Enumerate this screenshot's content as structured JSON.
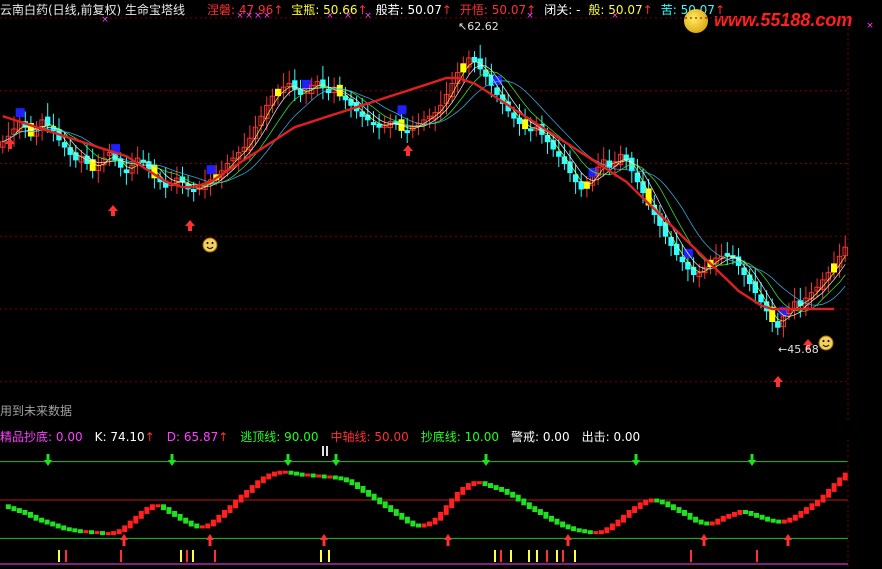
{
  "main_header": {
    "title": "云南白药(日线,前复权) 生命宝塔线",
    "items": [
      {
        "label": "涅磐",
        "value": "47.96",
        "color": "#ff3030",
        "arrow": true
      },
      {
        "label": "宝瓶",
        "value": "50.66",
        "color": "#ffff30",
        "arrow": true
      },
      {
        "label": "般若",
        "value": "50.07",
        "color": "#ffffff",
        "arrow": true
      },
      {
        "label": "开悟",
        "value": "50.07",
        "color": "#ff3030",
        "arrow": true
      },
      {
        "label": "闭关",
        "value": "-",
        "color": "#ffffff",
        "arrow": false
      },
      {
        "label": "般",
        "value": "50.07",
        "color": "#ffff30",
        "arrow": true
      },
      {
        "label": "苦",
        "value": "50.07",
        "color": "#30ffff",
        "arrow": true
      }
    ]
  },
  "watermark": "www.55188.com",
  "future_note": "用到未来数据",
  "high_label": "62.62",
  "low_label": "45.68",
  "sub_header": {
    "items": [
      {
        "label": "精品抄底",
        "value": "0.00",
        "color": "#ff40ff",
        "arrow": false
      },
      {
        "label": "K",
        "value": "74.10",
        "color": "#ffffff",
        "arrow": true
      },
      {
        "label": "D",
        "value": "65.87",
        "color": "#ff40ff",
        "arrow": true
      },
      {
        "label": "逃顶线",
        "value": "90.00",
        "color": "#20ff20",
        "arrow": false
      },
      {
        "label": "中轴线",
        "value": "50.00",
        "color": "#ff3030",
        "arrow": false
      },
      {
        "label": "抄底线",
        "value": "10.00",
        "color": "#20ff20",
        "arrow": false
      },
      {
        "label": "警戒",
        "value": "0.00",
        "color": "#ffffff",
        "arrow": false
      },
      {
        "label": "出击",
        "value": "0.00",
        "color": "#ffffff",
        "arrow": false
      }
    ]
  },
  "colors": {
    "up": "#ff3030",
    "down": "#30ffff",
    "yellow": "#ffff00",
    "blue": "#2020ff",
    "ma_long": "#e02020",
    "grid": "#7a0000",
    "kdj_up": "#ff2020",
    "kdj_down": "#20e020",
    "line90": "#20c020",
    "line50": "#c01818",
    "line10": "#20c020"
  },
  "chart_data": [
    {
      "type": "candlestick",
      "title": "云南白药(日线,前复权)",
      "ylim": [
        43,
        64
      ],
      "annotations": [
        {
          "kind": "max",
          "value": 62.62
        },
        {
          "kind": "min",
          "value": 45.68
        }
      ],
      "close": [
        57.2,
        57.5,
        57.9,
        58.3,
        58.0,
        57.6,
        57.9,
        58.4,
        58.1,
        57.8,
        57.3,
        56.9,
        56.5,
        56.2,
        56.4,
        56.0,
        55.7,
        55.9,
        56.3,
        56.6,
        56.2,
        55.8,
        55.5,
        55.9,
        56.3,
        56.1,
        55.7,
        55.3,
        55.0,
        54.7,
        54.9,
        55.2,
        55.0,
        54.6,
        54.5,
        54.7,
        54.9,
        55.1,
        55.3,
        55.6,
        56.0,
        56.3,
        56.6,
        56.9,
        57.4,
        58.0,
        58.6,
        59.2,
        59.7,
        60.0,
        60.2,
        60.4,
        60.1,
        59.8,
        60.0,
        60.3,
        60.5,
        60.2,
        59.9,
        60.1,
        59.8,
        59.5,
        59.2,
        58.9,
        58.6,
        58.4,
        58.2,
        58.0,
        58.1,
        58.3,
        58.2,
        57.9,
        57.8,
        58.0,
        58.2,
        58.4,
        58.6,
        58.8,
        59.2,
        59.8,
        60.4,
        61.0,
        61.4,
        61.8,
        61.6,
        61.2,
        60.8,
        60.3,
        59.8,
        59.3,
        58.9,
        58.5,
        58.2,
        58.0,
        57.8,
        58.0,
        57.6,
        57.2,
        56.8,
        56.4,
        56.0,
        55.5,
        55.0,
        54.6,
        54.9,
        55.3,
        55.8,
        56.2,
        55.8,
        56.1,
        56.5,
        56.2,
        55.6,
        55.0,
        54.4,
        53.8,
        53.2,
        52.6,
        52.0,
        51.5,
        51.0,
        50.6,
        50.2,
        49.9,
        50.0,
        50.3,
        50.6,
        50.8,
        50.9,
        51.0,
        50.8,
        50.4,
        49.9,
        49.4,
        48.9,
        48.4,
        47.9,
        47.4,
        47.0,
        47.6,
        48.0,
        48.4,
        48.2,
        48.6,
        48.9,
        49.2,
        49.6,
        50.0,
        50.4,
        50.9,
        51.4
      ],
      "ma_long": [
        58.6,
        58.5,
        58.4,
        58.3,
        58.2,
        58.1,
        58.0,
        57.9,
        57.8,
        57.7,
        57.6,
        57.5,
        57.4,
        57.3,
        57.2,
        57.1,
        57.0,
        56.9,
        56.8,
        56.7,
        56.6,
        56.5,
        56.4,
        56.2,
        56.0,
        55.8,
        55.6,
        55.4,
        55.2,
        55.0,
        54.9,
        54.8,
        54.7,
        54.7,
        54.7,
        54.8,
        54.9,
        55.0,
        55.2,
        55.4,
        55.6,
        55.8,
        56.0,
        56.2,
        56.4,
        56.6,
        56.8,
        57.0,
        57.2,
        57.4,
        57.6,
        57.8,
        58.0,
        58.1,
        58.2,
        58.3,
        58.4,
        58.5,
        58.6,
        58.7,
        58.8,
        58.9,
        59.0,
        59.1,
        59.2,
        59.3,
        59.4,
        59.5,
        59.6,
        59.7,
        59.8,
        59.9,
        60.0,
        60.1,
        60.2,
        60.3,
        60.4,
        60.5,
        60.6,
        60.7,
        60.7,
        60.7,
        60.6,
        60.5,
        60.4,
        60.2,
        60.0,
        59.8,
        59.6,
        59.4,
        59.2,
        59.0,
        58.8,
        58.6,
        58.4,
        58.2,
        58.0,
        57.8,
        57.6,
        57.4,
        57.2,
        57.0,
        56.8,
        56.6,
        56.4,
        56.2,
        56.0,
        55.8,
        55.6,
        55.4,
        55.2,
        55.0,
        54.7,
        54.4,
        54.1,
        53.8,
        53.5,
        53.2,
        52.9,
        52.6,
        52.3,
        52.0,
        51.7,
        51.4,
        51.1,
        50.8,
        50.5,
        50.2,
        49.9,
        49.6,
        49.3,
        49.0,
        48.8,
        48.6,
        48.4,
        48.2,
        48.1,
        48.0,
        48.0,
        48.0,
        48.0,
        48.0,
        48.0,
        48.0,
        48.0,
        48.0,
        48.0,
        48.0,
        48.0
      ]
    },
    {
      "type": "bar",
      "title": "精品抄底",
      "ylim": [
        0,
        100
      ],
      "reference_lines": [
        90,
        50,
        10
      ],
      "kdj": [
        44,
        42,
        40,
        38,
        36,
        33,
        30,
        28,
        26,
        24,
        22,
        20,
        19,
        18,
        17,
        17,
        16,
        16,
        15,
        15,
        16,
        18,
        22,
        27,
        32,
        37,
        41,
        44,
        44,
        41,
        37,
        34,
        30,
        27,
        24,
        22,
        22,
        24,
        28,
        33,
        38,
        43,
        49,
        54,
        59,
        64,
        69,
        73,
        76,
        78,
        79,
        79,
        78,
        77,
        76,
        76,
        75,
        75,
        74,
        74,
        73,
        72,
        70,
        67,
        63,
        59,
        55,
        51,
        47,
        43,
        39,
        35,
        31,
        27,
        24,
        23,
        24,
        26,
        30,
        36,
        43,
        50,
        57,
        62,
        66,
        68,
        68,
        66,
        64,
        62,
        60,
        57,
        54,
        50,
        46,
        42,
        39,
        36,
        32,
        29,
        26,
        23,
        21,
        19,
        18,
        17,
        16,
        16,
        17,
        20,
        24,
        28,
        33,
        38,
        42,
        46,
        49,
        50,
        49,
        47,
        44,
        41,
        38,
        35,
        31,
        28,
        26,
        25,
        26,
        29,
        32,
        34,
        36,
        38,
        37,
        35,
        33,
        31,
        29,
        28,
        27,
        28,
        30,
        33,
        37,
        41,
        45,
        49,
        54,
        60,
        66,
        72,
        77
      ]
    }
  ]
}
